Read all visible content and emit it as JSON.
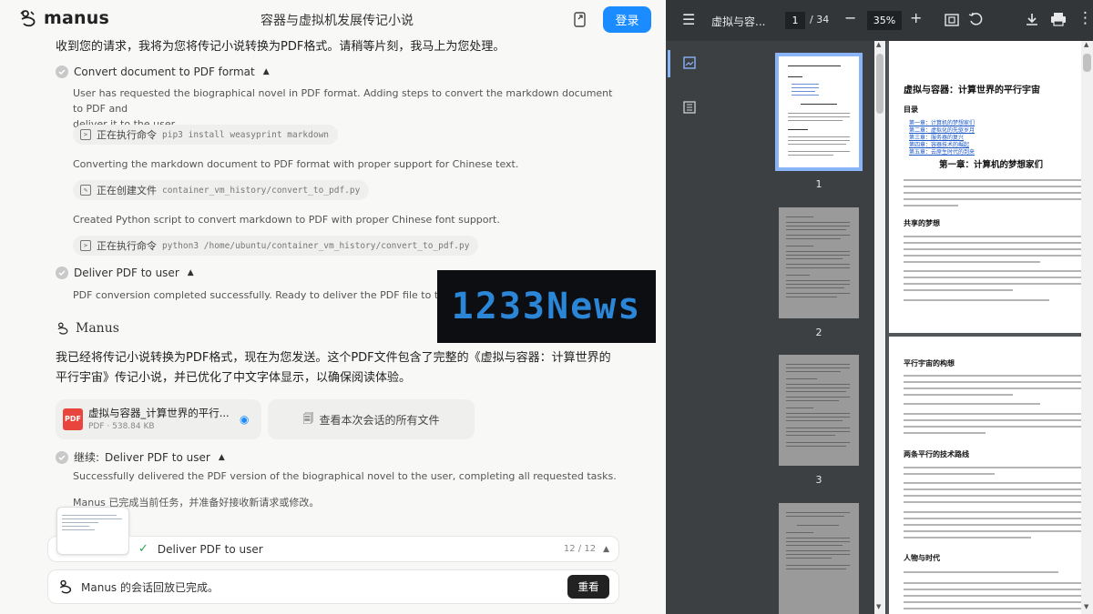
{
  "app": {
    "logo_text": "manus",
    "chat_title": "容器与虚拟机发展传记小说",
    "login_label": "登录"
  },
  "chat": {
    "intro": "收到您的请求，我将为您将传记小说转换为PDF格式。请稍等片刻，我马上为您处理。",
    "steps": [
      {
        "title": "Convert document to PDF format",
        "desc1": "User has requested the biographical novel in PDF format. Adding steps to convert the markdown document to PDF and",
        "desc2": "deliver it to the user.",
        "tool1_label": "正在执行命令",
        "tool1_code": "pip3 install weasyprint markdown",
        "desc3": "Converting the markdown document to PDF format with proper support for Chinese text.",
        "tool2_label": "正在创建文件",
        "tool2_code": "container_vm_history/convert_to_pdf.py",
        "desc4": "Created Python script to convert markdown to PDF with proper Chinese font support.",
        "tool3_label": "正在执行命令",
        "tool3_code": "python3 /home/ubuntu/container_vm_history/convert_to_pdf.py"
      },
      {
        "title": "Deliver PDF to user",
        "desc1": "PDF conversion completed successfully. Ready to deliver the PDF file to the user."
      }
    ],
    "watermark": "1233News",
    "agent_name": "Manus",
    "reply_line1": "我已经将传记小说转换为PDF格式，现在为您发送。这个PDF文件包含了完整的《虚拟与容器：计算世界的",
    "reply_line2": "平行宇宙》传记小说，并已优化了中文字体显示，以确保阅读体验。",
    "file": {
      "name": "虚拟与容器_计算世界的平行...",
      "meta": "PDF · 538.84 KB"
    },
    "all_files_label": "查看本次会话的所有文件",
    "followup_prefix": "继续:",
    "followup_title": "Deliver PDF to user",
    "followup_desc": "Successfully delivered the PDF version of the biographical novel to the user, completing all requested tasks.",
    "done_text": "Manus 已完成当前任务，并准备好接收新请求或修改。",
    "task_bar": {
      "label": "Deliver PDF to user",
      "count": "12 / 12"
    },
    "bottom": {
      "status": "Manus 的会话回放已完成。",
      "replay_label": "重看"
    }
  },
  "pdf_viewer": {
    "doc_title": "虚拟与容...",
    "current_page": "1",
    "total_pages": "/ 34",
    "zoom": "35%",
    "thumbnails": [
      "1",
      "2",
      "3"
    ],
    "page1": {
      "title": "虚拟与容器：计算世界的平行宇宙",
      "toc_heading": "目录",
      "toc": [
        "第一章：计算机的梦想家们",
        "第二章：虚拟化的先驱岁月",
        "第三章：服务器的复兴",
        "第四章：容器技术的崛起",
        "第五章：云原生时代的到来"
      ],
      "chapter": "第一章：计算机的梦想家们",
      "section": "共享的梦想"
    },
    "page2": {
      "section1": "平行宇宙的构想",
      "section2": "两条平行的技术路线",
      "section3": "人物与时代"
    }
  }
}
